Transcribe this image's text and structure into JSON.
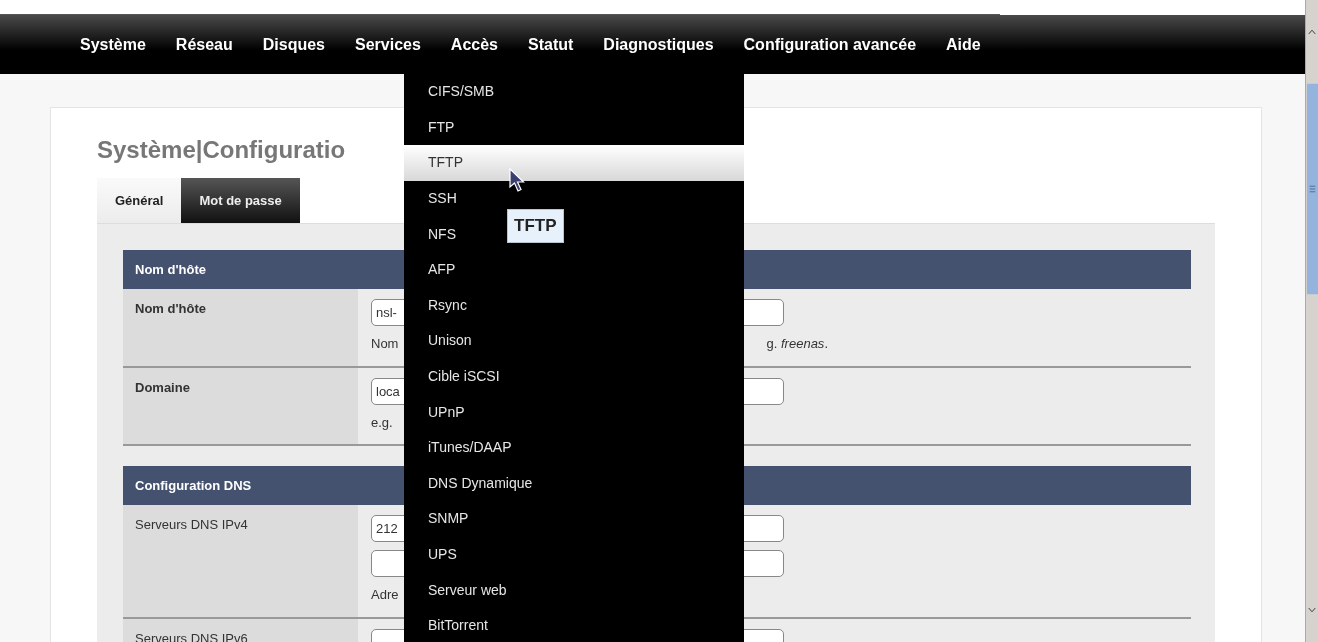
{
  "navbar": {
    "items": [
      {
        "label": "Système"
      },
      {
        "label": "Réseau"
      },
      {
        "label": "Disques"
      },
      {
        "label": "Services",
        "menu": [
          {
            "label": "CIFS/SMB",
            "selected": false
          },
          {
            "label": "FTP",
            "selected": false
          },
          {
            "label": "TFTP",
            "selected": true
          },
          {
            "label": "SSH",
            "selected": false
          },
          {
            "label": "NFS",
            "selected": false
          },
          {
            "label": "AFP",
            "selected": false
          },
          {
            "label": "Rsync",
            "selected": false
          },
          {
            "label": "Unison",
            "selected": false
          },
          {
            "label": "Cible iSCSI",
            "selected": false
          },
          {
            "label": "UPnP",
            "selected": false
          },
          {
            "label": "iTunes/DAAP",
            "selected": false
          },
          {
            "label": "DNS Dynamique",
            "selected": false
          },
          {
            "label": "SNMP",
            "selected": false
          },
          {
            "label": "UPS",
            "selected": false
          },
          {
            "label": "Serveur web",
            "selected": false
          },
          {
            "label": "BitTorrent",
            "selected": false
          }
        ]
      },
      {
        "label": "Accès"
      },
      {
        "label": "Statut"
      },
      {
        "label": "Diagnostiques"
      },
      {
        "label": "Configuration avancée"
      },
      {
        "label": "Aide"
      }
    ]
  },
  "tooltip": "TFTP",
  "page": {
    "title": "Système|Configuratio",
    "tabs": [
      {
        "label": "Général",
        "selected": true
      },
      {
        "label": "Mot de passe",
        "selected": false
      }
    ],
    "sections": [
      {
        "title": "Nom d'hôte",
        "rows": [
          {
            "label": "Nom d'hôte",
            "required": true,
            "fields": [
              {
                "kind": "text",
                "value": "nsl-"
              }
            ],
            "help": [
              "Nom",
              "g. *freenas*."
            ]
          },
          {
            "label": "Domaine",
            "required": true,
            "fields": [
              {
                "kind": "text",
                "value": "loca"
              }
            ],
            "help": [
              "e.g."
            ]
          }
        ]
      },
      {
        "title": "Configuration DNS",
        "rows": [
          {
            "label": "Serveurs DNS IPv4",
            "required": false,
            "fields": [
              {
                "kind": "text",
                "value": "212"
              },
              {
                "kind": "text"
              }
            ],
            "help": [
              "Adre"
            ]
          },
          {
            "label": "Serveurs DNS IPv6",
            "required": false,
            "fields": [
              {
                "kind": "text"
              }
            ]
          }
        ]
      }
    ]
  }
}
